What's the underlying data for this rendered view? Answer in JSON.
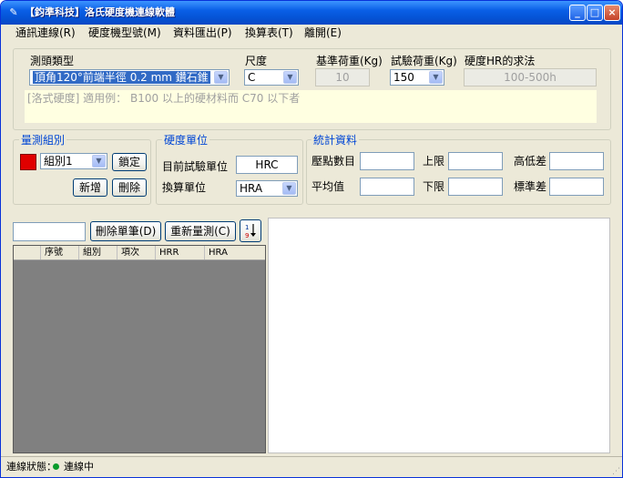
{
  "window": {
    "title": "【鈞準科技】洛氏硬度機連線軟體"
  },
  "menu": [
    "通訊連線(R)",
    "硬度機型號(M)",
    "資料匯出(P)",
    "換算表(T)",
    "離開(E)"
  ],
  "params": {
    "indenter_label": "測頭類型",
    "indenter_value": "頂角120°前端半徑 0.2 mm 鑽石錐",
    "scale_label": "尺度",
    "scale_value": "C",
    "base_load_label": "基準荷重(Kg)",
    "base_load_value": "10",
    "test_load_label": "試驗荷重(Kg)",
    "test_load_value": "150",
    "hr_label": "硬度HR的求法",
    "hr_value": "100-500h",
    "note": "[洛式硬度] 適用例：  B100 以上的硬材料而 C70 以下者"
  },
  "group_box": {
    "title": "量測組別",
    "combo_value": "組別1",
    "lock": "鎖定",
    "add": "新增",
    "delete": "刪除"
  },
  "unit_box": {
    "title": "硬度單位",
    "current_label": "目前試驗單位",
    "current_value": "HRC",
    "convert_label": "換算單位",
    "convert_value": "HRA"
  },
  "stats_box": {
    "title": "統計資料",
    "points_label": "壓點數目",
    "upper_label": "上限",
    "range_label": "高低差",
    "mean_label": "平均值",
    "lower_label": "下限",
    "stdev_label": "標準差"
  },
  "toolbar": {
    "delete_single": "刪除單筆(D)",
    "remeasure": "重新量測(C)"
  },
  "table": {
    "columns": [
      "序號",
      "組別",
      "項次",
      "HRR",
      "HRA"
    ]
  },
  "status": {
    "label": "連線狀態：",
    "value": "連線中"
  }
}
